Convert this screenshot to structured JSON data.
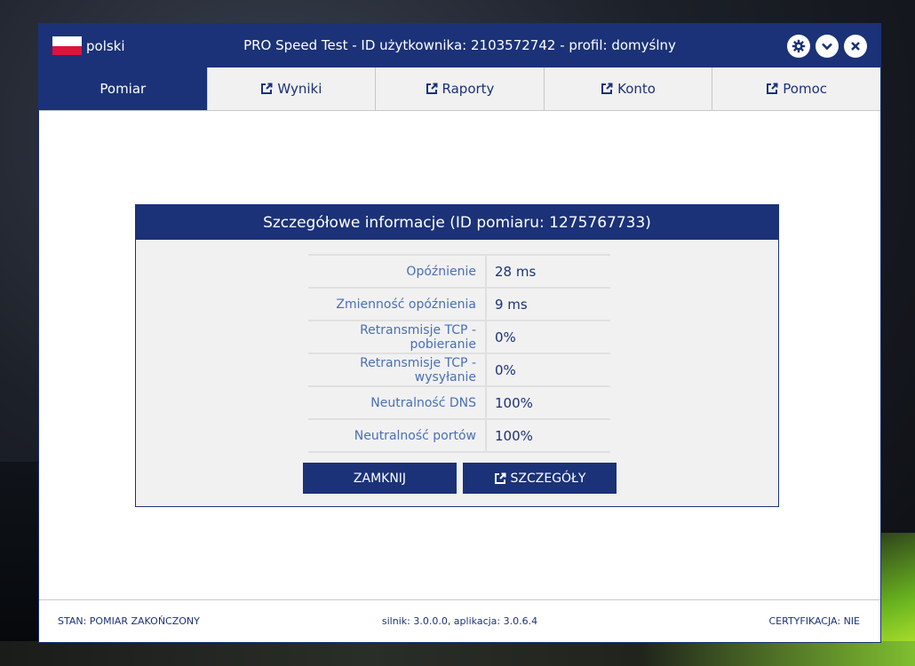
{
  "window": {
    "language": "polski",
    "title": "PRO Speed Test - ID użytkownika: 2103572742 - profil: domyślny",
    "buttons": [
      "gear-icon",
      "chevron-down-icon",
      "close-icon"
    ]
  },
  "tabs": [
    {
      "label": "Pomiar",
      "active": true,
      "external": false
    },
    {
      "label": "Wyniki",
      "active": false,
      "external": true
    },
    {
      "label": "Raporty",
      "active": false,
      "external": true
    },
    {
      "label": "Konto",
      "active": false,
      "external": true
    },
    {
      "label": "Pomoc",
      "active": false,
      "external": true
    }
  ],
  "panel": {
    "title": "Szczegółowe informacje (ID pomiaru: 1275767733)",
    "rows": [
      {
        "label": "Opóźnienie",
        "value": "28 ms"
      },
      {
        "label": "Zmienność opóźnienia",
        "value": "9 ms"
      },
      {
        "label": "Retransmisje TCP - pobieranie",
        "value": "0%"
      },
      {
        "label": "Retransmisje TCP - wysyłanie",
        "value": "0%"
      },
      {
        "label": "Neutralność DNS",
        "value": "100%"
      },
      {
        "label": "Neutralność portów",
        "value": "100%"
      }
    ],
    "close_label": "ZAMKNIJ",
    "details_label": "SZCZEGÓŁY"
  },
  "status": {
    "state": "STAN: POMIAR ZAKOŃCZONY",
    "version": "silnik: 3.0.0.0, aplikacja: 3.0.6.4",
    "certification": "CERTYFIKACJA: NIE"
  },
  "colors": {
    "primary": "#1b3278",
    "label": "#4a6fb5",
    "panel_bg": "#f1f1f1"
  }
}
